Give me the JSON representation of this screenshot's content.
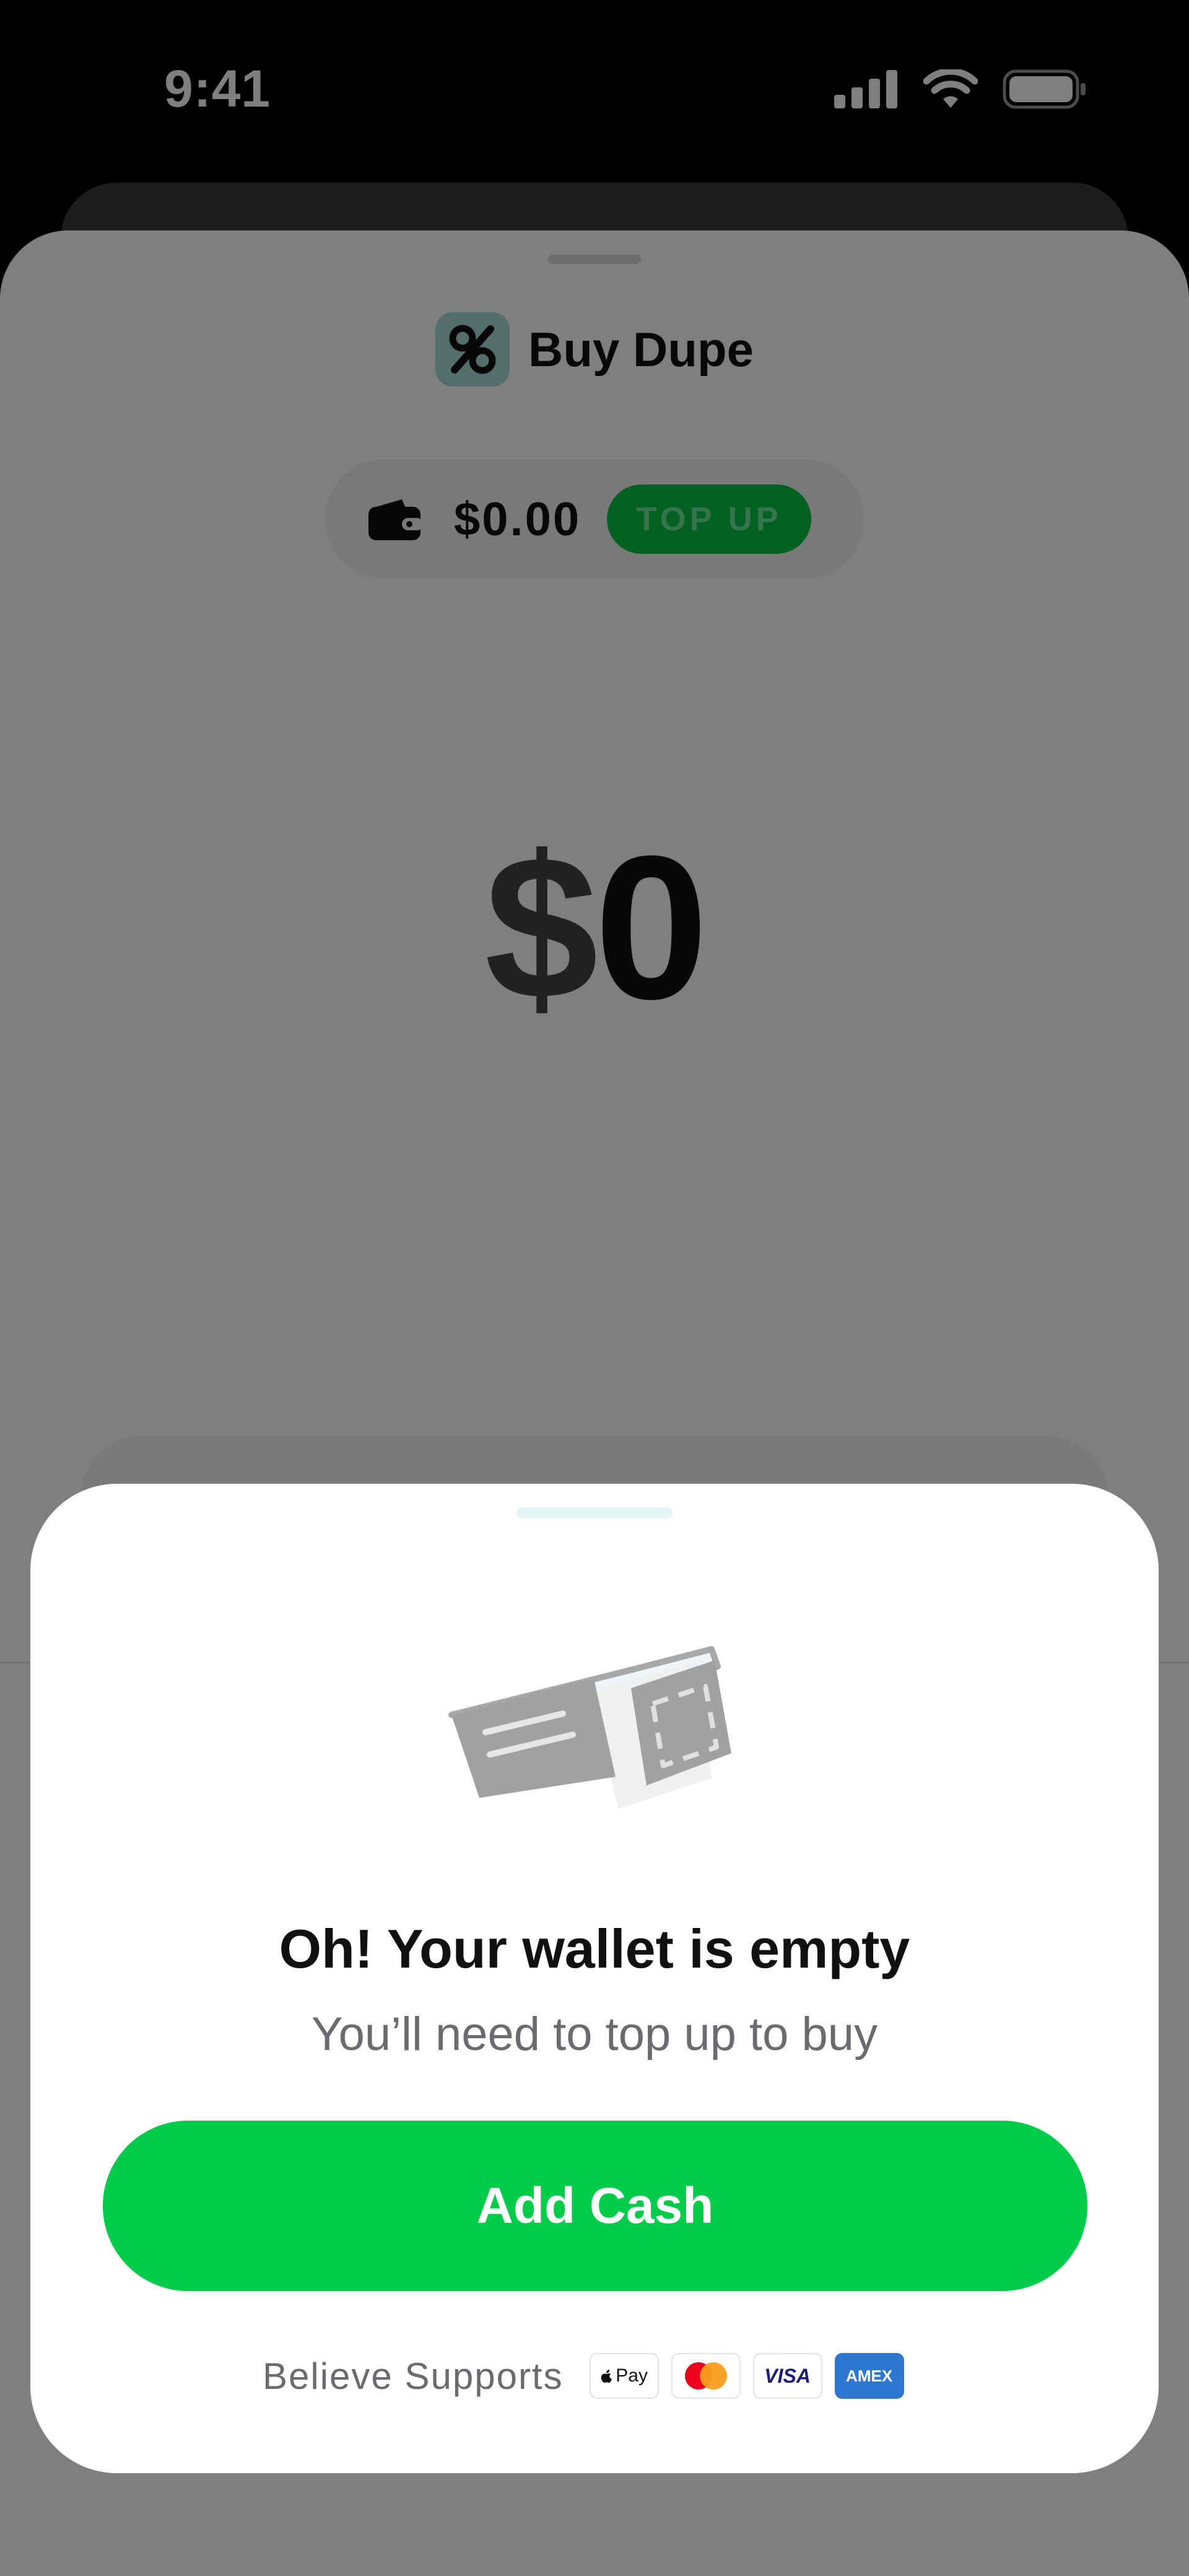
{
  "status_bar": {
    "time": "9:41"
  },
  "app": {
    "name": "Buy Dupe",
    "logo_symbol": "%"
  },
  "wallet": {
    "balance": "$0.00",
    "topup_label": "TOP UP"
  },
  "amount": {
    "currency": "$",
    "value": "0"
  },
  "modal": {
    "title": "Oh! Your wallet is empty",
    "subtitle": "You’ll need to top up to buy",
    "add_cash_label": "Add Cash",
    "supports_label": "Believe Supports",
    "payment_methods": [
      "Apple Pay",
      "Mastercard",
      "VISA",
      "AMEX"
    ]
  },
  "colors": {
    "accent_green": "#00cc4a",
    "topup_green": "#00c244"
  }
}
